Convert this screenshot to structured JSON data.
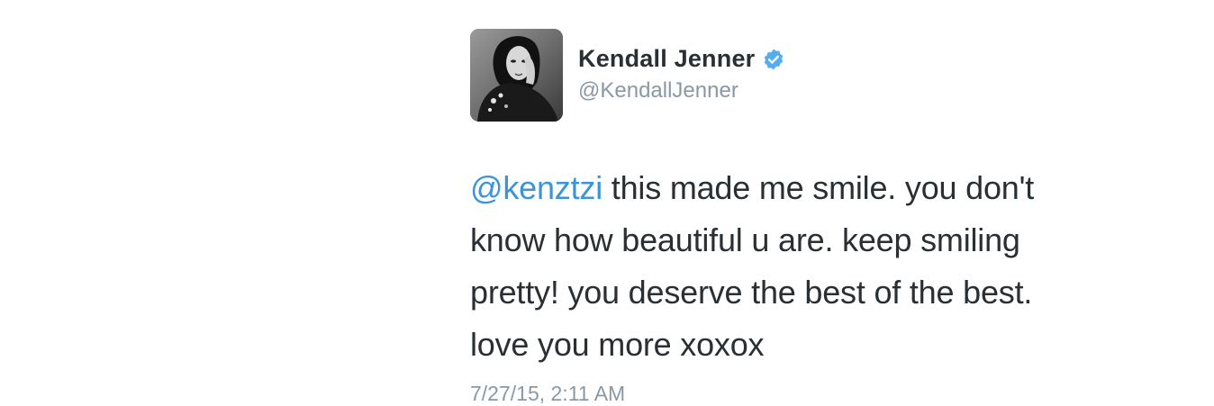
{
  "tweet": {
    "author": {
      "display_name": "Kendall Jenner",
      "handle": "@KendallJenner",
      "verified": true
    },
    "text": {
      "mention": "@kenztzi",
      "line1_rest": " this made me smile. you don't",
      "line2": "know how beautiful u are. keep smiling",
      "line3": "pretty! you deserve the best of the best.",
      "line4": "love you more xoxox"
    },
    "timestamp": "7/27/15, 2:11 AM"
  },
  "colors": {
    "mention": "#3b94d9",
    "verified_badge": "#55acee",
    "text": "#292f33",
    "muted": "#8899a6"
  },
  "icons": {
    "verified": "verified-badge-icon",
    "avatar": "profile-photo"
  }
}
